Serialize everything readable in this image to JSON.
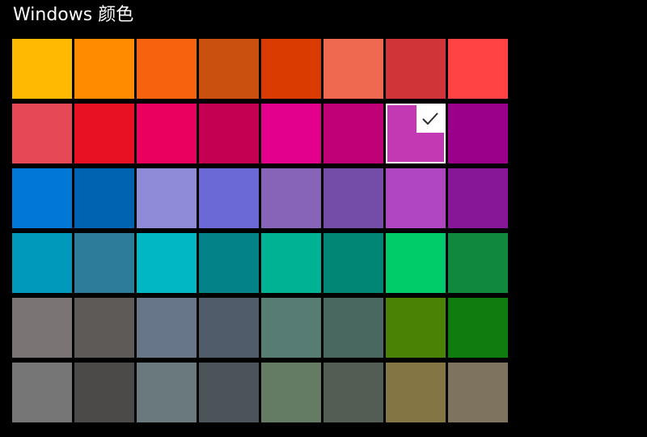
{
  "header": {
    "title": "Windows 颜色"
  },
  "palette": {
    "selected_index": 14,
    "check_icon": "checkmark-icon",
    "check_color": "#2b2b2b",
    "rows": [
      [
        "#FFB900",
        "#FF8C00",
        "#F7630C",
        "#CA5010",
        "#DA3B01",
        "#EF6950",
        "#D13438",
        "#FF4343"
      ],
      [
        "#E74856",
        "#E81123",
        "#EA005E",
        "#C30052",
        "#E3008C",
        "#BF0077",
        "#C239B3",
        "#9A0089"
      ],
      [
        "#0078D7",
        "#0063B1",
        "#8E8CD8",
        "#6B69D6",
        "#8764B8",
        "#744DA9",
        "#B146C2",
        "#881798"
      ],
      [
        "#0099BC",
        "#2D7D9A",
        "#00B7C3",
        "#038387",
        "#00B294",
        "#018574",
        "#00CC6A",
        "#10893E"
      ],
      [
        "#7A7574",
        "#5D5A58",
        "#68768A",
        "#515C6B",
        "#567C73",
        "#486860",
        "#498205",
        "#107C10"
      ],
      [
        "#767676",
        "#4C4A48",
        "#69797E",
        "#4A5459",
        "#647C64",
        "#525E54",
        "#847545",
        "#7E735F"
      ]
    ]
  }
}
